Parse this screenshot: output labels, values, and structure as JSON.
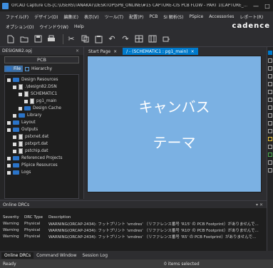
{
  "window": {
    "title": "OrCAD Capture CIS-[C:\\USERS\\TANAKAT\\DESKTOP\\SPB_ONLINE\\#15 CAPTURE-CIS PCB FLOW - PART 1\\CAPTURE_...",
    "minimize": "—",
    "maximize": "□"
  },
  "menu": {
    "row1": [
      "ファイル(F)",
      "デザイン(D)",
      "編集(E)",
      "表示(V)",
      "ツール(T)",
      "配置(P)",
      "PCB",
      "SI 解析(S)",
      "PSpice",
      "Accessories",
      "レポート(R)"
    ],
    "row2": [
      "オプション(O)",
      "ウインドウ(W)",
      "Help"
    ],
    "brand": "cadence"
  },
  "toolbar": {
    "icons": [
      "new-file",
      "open-folder",
      "save",
      "print",
      "cut",
      "copy",
      "paste",
      "undo",
      "redo",
      "netlist",
      "grid",
      "part"
    ]
  },
  "left_panel": {
    "tab_label": "DESIGN82.opj",
    "tab_close": "×",
    "title": "PCB",
    "subtabs": {
      "file": "File",
      "hierarchy": "Hierarchy"
    },
    "tree": [
      {
        "label": "Design Resources",
        "indent": 0,
        "icon": "folder"
      },
      {
        "label": ".\\design82.DSN",
        "indent": 1,
        "icon": "file"
      },
      {
        "label": "SCHEMATIC1",
        "indent": 2,
        "icon": "file"
      },
      {
        "label": "pg1_main",
        "indent": 3,
        "icon": "file"
      },
      {
        "label": "Design Cache",
        "indent": 2,
        "icon": "folder"
      },
      {
        "label": "Library",
        "indent": 1,
        "icon": "folder"
      },
      {
        "label": "Layout",
        "indent": 0,
        "icon": "folder"
      },
      {
        "label": "Outputs",
        "indent": 0,
        "icon": "folder"
      },
      {
        "label": "pstxnet.dat",
        "indent": 1,
        "icon": "file"
      },
      {
        "label": "pstxprt.dat",
        "indent": 1,
        "icon": "file"
      },
      {
        "label": "pstchip.dat",
        "indent": 1,
        "icon": "file"
      },
      {
        "label": "Referenced Projects",
        "indent": 0,
        "icon": "folder"
      },
      {
        "label": "PSpice Resources",
        "indent": 0,
        "icon": "folder"
      },
      {
        "label": "Logs",
        "indent": 0,
        "icon": "folder"
      }
    ]
  },
  "doc_tabs": [
    {
      "label": "Start Page",
      "active": false
    },
    {
      "label": "/ - (SCHEMATIC1 : pg1_main)",
      "active": true
    }
  ],
  "canvas": {
    "line1": "キャンバス",
    "line2": "テーマ",
    "color": "#7bb1e3"
  },
  "drc_panel": {
    "title": "Online DRCs",
    "controls": "▾ ✕",
    "headers": {
      "severity": "Severity",
      "type": "DRC Type",
      "desc": "Description"
    },
    "rows": [
      {
        "severity": "Warning",
        "type": "Physical",
        "desc": "WARNING(ORCAP-2434): フットプリント 'smdres' （リファレンス番号 'R15' の PCB Footprint）がありませんで..."
      },
      {
        "severity": "Warning",
        "type": "Physical",
        "desc": "WARNING(ORCAP-2434): フットプリント 'smdres' （リファレンス番号 'R10' の PCB Footprint）がありませんで..."
      },
      {
        "severity": "Warning",
        "type": "Physical",
        "desc": "WARNING(ORCAP-2434): フットプリント 'smdres' （リファレンス番号 'R5' の PCB Footprint）がありませんで..."
      }
    ]
  },
  "bottom_tabs": [
    "Online DRCs",
    "Command Window",
    "Session Log"
  ],
  "status": {
    "left": "Ready",
    "center": "0 items selected"
  }
}
